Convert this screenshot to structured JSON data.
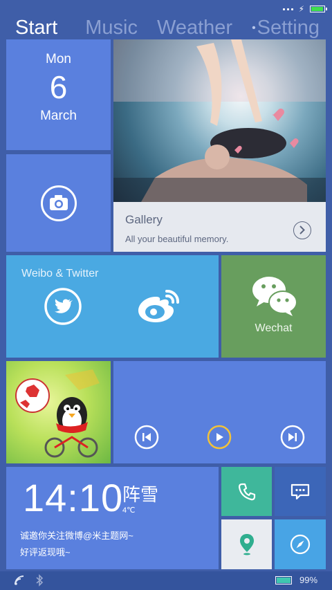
{
  "status_bar": {
    "battery_level": 0.95,
    "battery_color": "#3fe04c"
  },
  "tabs": [
    {
      "label": "Start",
      "active": true
    },
    {
      "label": "Music",
      "active": false
    },
    {
      "label": "Weather",
      "active": false
    },
    {
      "label": "Setting",
      "active": false
    }
  ],
  "date_tile": {
    "weekday": "Mon",
    "day": "6",
    "month": "March"
  },
  "camera_tile": {
    "icon": "camera-icon"
  },
  "gallery_tile": {
    "title": "Gallery",
    "subtitle": "All your beautiful memory.",
    "icon": "chevron-right-icon"
  },
  "social_tile": {
    "title": "Weibo & Twitter",
    "icons": [
      "twitter-icon",
      "weibo-icon"
    ]
  },
  "wechat_tile": {
    "label": "Wechat",
    "icon": "wechat-icon"
  },
  "player_tile": {
    "controls": [
      "previous-icon",
      "play-icon",
      "next-icon"
    ],
    "accent": "#f2c23a"
  },
  "clock_tile": {
    "time": "14:10",
    "condition": "阵雪",
    "temperature": "4℃",
    "message_line1": "诚邀你关注微博@米主题网~",
    "message_line2": "好评返现哦~"
  },
  "small_tiles": [
    {
      "icon": "phone-icon",
      "color": "#3fb79b"
    },
    {
      "icon": "message-icon",
      "color": "#3c66b8"
    },
    {
      "icon": "map-pin-icon",
      "color": "#e9ecf1"
    },
    {
      "icon": "compass-icon",
      "color": "#48a4e5"
    }
  ],
  "bottom_bar": {
    "battery_percent": "99%",
    "battery_level": 0.99
  }
}
